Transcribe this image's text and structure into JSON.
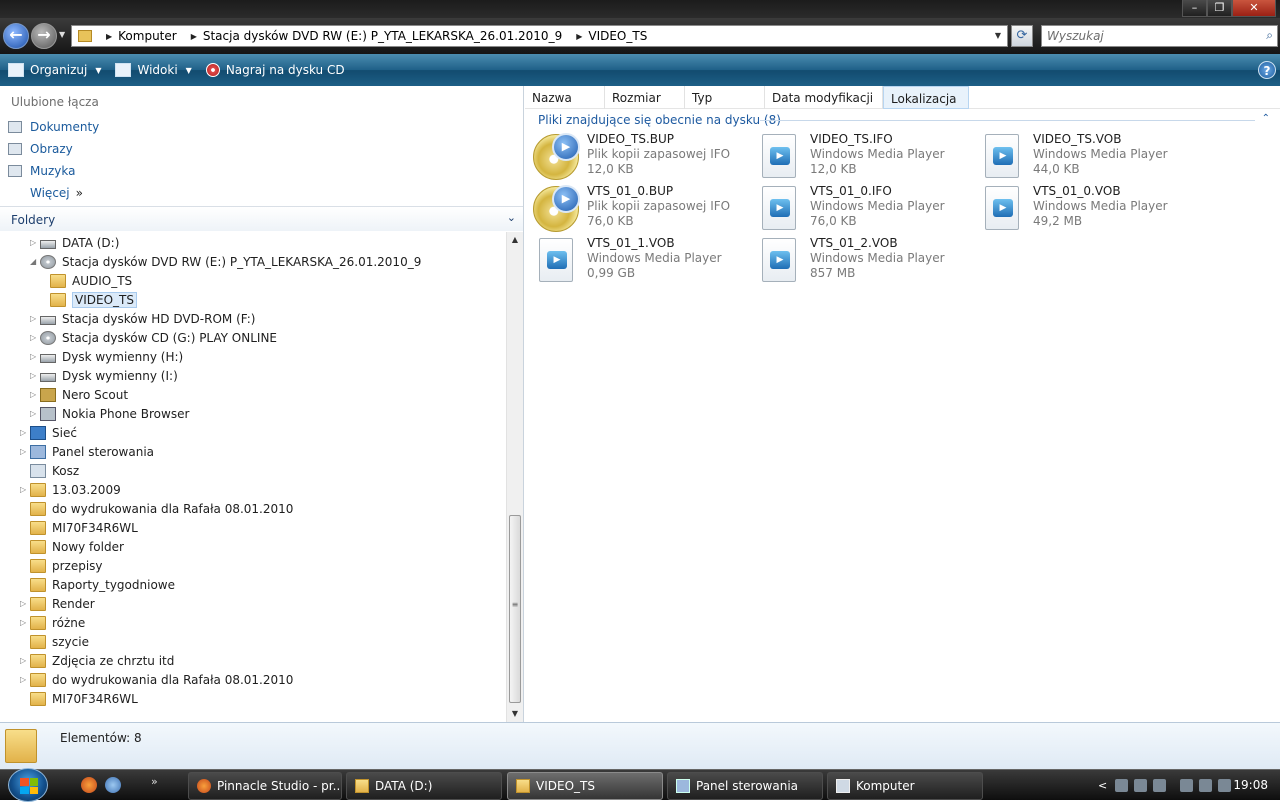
{
  "window": {
    "controls": {
      "minimize": "–",
      "maximize": "❐",
      "close": "✕"
    }
  },
  "address_bar": {
    "breadcrumbs": [
      "Komputer",
      "Stacja dysków DVD RW (E:) P_YTA_LEKARSKA_26.01.2010_9",
      "VIDEO_TS"
    ],
    "search_placeholder": "Wyszukaj"
  },
  "toolbar": {
    "organize": "Organizuj",
    "views": "Widoki",
    "burn": "Nagraj na dysku CD"
  },
  "sidebar": {
    "favorites_title": "Ulubione łącza",
    "favorites": [
      {
        "label": "Dokumenty",
        "icon": "documents-icon"
      },
      {
        "label": "Obrazy",
        "icon": "pictures-icon"
      },
      {
        "label": "Muzyka",
        "icon": "music-icon"
      }
    ],
    "more": "Więcej",
    "folders_title": "Foldery"
  },
  "tree": [
    {
      "label": "DATA (D:)",
      "icon": "drive",
      "expand": "▷"
    },
    {
      "label": "Stacja dysków DVD RW (E:) P_YTA_LEKARSKA_26.01.2010_9",
      "icon": "dvd",
      "expand": "◢"
    },
    {
      "label": "AUDIO_TS",
      "icon": "folder",
      "expand": ""
    },
    {
      "label": "VIDEO_TS",
      "icon": "folder",
      "expand": "",
      "selected": true
    },
    {
      "label": "Stacja dysków HD DVD-ROM (F:)",
      "icon": "drive",
      "expand": "▷"
    },
    {
      "label": "Stacja dysków CD (G:) PLAY ONLINE",
      "icon": "dvd",
      "expand": "▷"
    },
    {
      "label": "Dysk wymienny (H:)",
      "icon": "drive",
      "expand": "▷"
    },
    {
      "label": "Dysk wymienny (I:)",
      "icon": "drive",
      "expand": "▷"
    },
    {
      "label": "Nero Scout",
      "icon": "app",
      "expand": "▷"
    },
    {
      "label": "Nokia Phone Browser",
      "icon": "phone",
      "expand": "▷"
    },
    {
      "label": "Sieć",
      "icon": "net",
      "expand": "▷"
    },
    {
      "label": "Panel sterowania",
      "icon": "panel",
      "expand": "▷"
    },
    {
      "label": "Kosz",
      "icon": "bin",
      "expand": ""
    },
    {
      "label": "13.03.2009",
      "icon": "folder",
      "expand": "▷"
    },
    {
      "label": "do wydrukowania dla Rafała 08.01.2010",
      "icon": "folder",
      "expand": ""
    },
    {
      "label": "MI70F34R6WL",
      "icon": "folder",
      "expand": ""
    },
    {
      "label": "Nowy folder",
      "icon": "folder",
      "expand": ""
    },
    {
      "label": "przepisy",
      "icon": "folder",
      "expand": ""
    },
    {
      "label": "Raporty_tygodniowe",
      "icon": "folder",
      "expand": ""
    },
    {
      "label": "Render",
      "icon": "folder",
      "expand": "▷"
    },
    {
      "label": "różne",
      "icon": "folder",
      "expand": "▷"
    },
    {
      "label": "szycie",
      "icon": "folder",
      "expand": ""
    },
    {
      "label": "Zdjęcia ze chrztu itd",
      "icon": "folder",
      "expand": "▷"
    },
    {
      "label": "do wydrukowania dla Rafała 08.01.2010",
      "icon": "folder",
      "expand": "▷"
    },
    {
      "label": "MI70F34R6WL",
      "icon": "folder",
      "expand": ""
    }
  ],
  "columns": [
    "Nazwa",
    "Rozmiar",
    "Typ",
    "Data modyfikacji",
    "Lokalizacja"
  ],
  "group_header": "Pliki znajdujące się obecnie na dysku (8)",
  "files": [
    {
      "name": "VIDEO_TS.BUP",
      "type": "Plik kopii zapasowej IFO",
      "size": "12,0 KB",
      "icon": "disc-play-icon"
    },
    {
      "name": "VIDEO_TS.IFO",
      "type": "Windows Media Player",
      "size": "12,0 KB",
      "icon": "media-file-icon"
    },
    {
      "name": "VIDEO_TS.VOB",
      "type": "Windows Media Player",
      "size": "44,0 KB",
      "icon": "media-file-icon"
    },
    {
      "name": "VTS_01_0.BUP",
      "type": "Plik kopii zapasowej IFO",
      "size": "76,0 KB",
      "icon": "disc-play-icon"
    },
    {
      "name": "VTS_01_0.IFO",
      "type": "Windows Media Player",
      "size": "76,0 KB",
      "icon": "media-file-icon"
    },
    {
      "name": "VTS_01_0.VOB",
      "type": "Windows Media Player",
      "size": "49,2 MB",
      "icon": "media-file-icon"
    },
    {
      "name": "VTS_01_1.VOB",
      "type": "Windows Media Player",
      "size": "0,99 GB",
      "icon": "media-file-icon"
    },
    {
      "name": "VTS_01_2.VOB",
      "type": "Windows Media Player",
      "size": "857 MB",
      "icon": "media-file-icon"
    }
  ],
  "status": {
    "text": "Elementów: 8"
  },
  "taskbar": {
    "buttons": [
      {
        "label": "Pinnacle Studio - pr...",
        "icon": "firefox-icon"
      },
      {
        "label": "DATA (D:)",
        "icon": "folder-icon"
      },
      {
        "label": "VIDEO_TS",
        "icon": "folder-icon",
        "active": true
      },
      {
        "label": "Panel sterowania",
        "icon": "control-panel-icon"
      },
      {
        "label": "Komputer",
        "icon": "computer-icon"
      }
    ],
    "clock": "19:08"
  }
}
